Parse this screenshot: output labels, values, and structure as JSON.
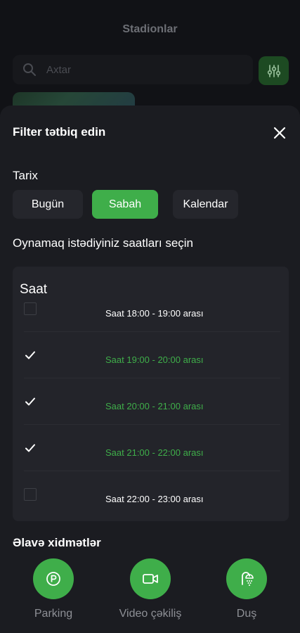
{
  "background": {
    "title": "Stadionlar",
    "search_placeholder": "Axtar"
  },
  "sheet": {
    "title": "Filter tətbiq edin",
    "date_section": {
      "label": "Tarix",
      "options": [
        "Bugün",
        "Sabah",
        "Kalendar"
      ],
      "selected": "Sabah"
    },
    "time_section": {
      "label": "Oynamaq istədiyiniz saatları seçin",
      "card_title": "Saat",
      "slots": [
        {
          "label": "Saat 18:00 - 19:00 arası",
          "checked": false
        },
        {
          "label": "Saat 19:00 - 20:00 arası",
          "checked": true
        },
        {
          "label": "Saat 20:00 - 21:00 arası",
          "checked": true
        },
        {
          "label": "Saat 21:00 - 22:00 arası",
          "checked": true
        },
        {
          "label": "Saat 22:00 - 23:00 arası",
          "checked": false
        }
      ]
    },
    "services_section": {
      "label": "Əlavə xidmətlər",
      "items": [
        {
          "label": "Parking",
          "icon": "parking-icon"
        },
        {
          "label": "Video çəkiliş",
          "icon": "video-camera-icon"
        },
        {
          "label": "Duş",
          "icon": "shower-icon"
        }
      ]
    }
  },
  "colors": {
    "accent": "#3fae4a",
    "sheet_bg": "#1b1c21",
    "card_bg": "#23242a"
  }
}
